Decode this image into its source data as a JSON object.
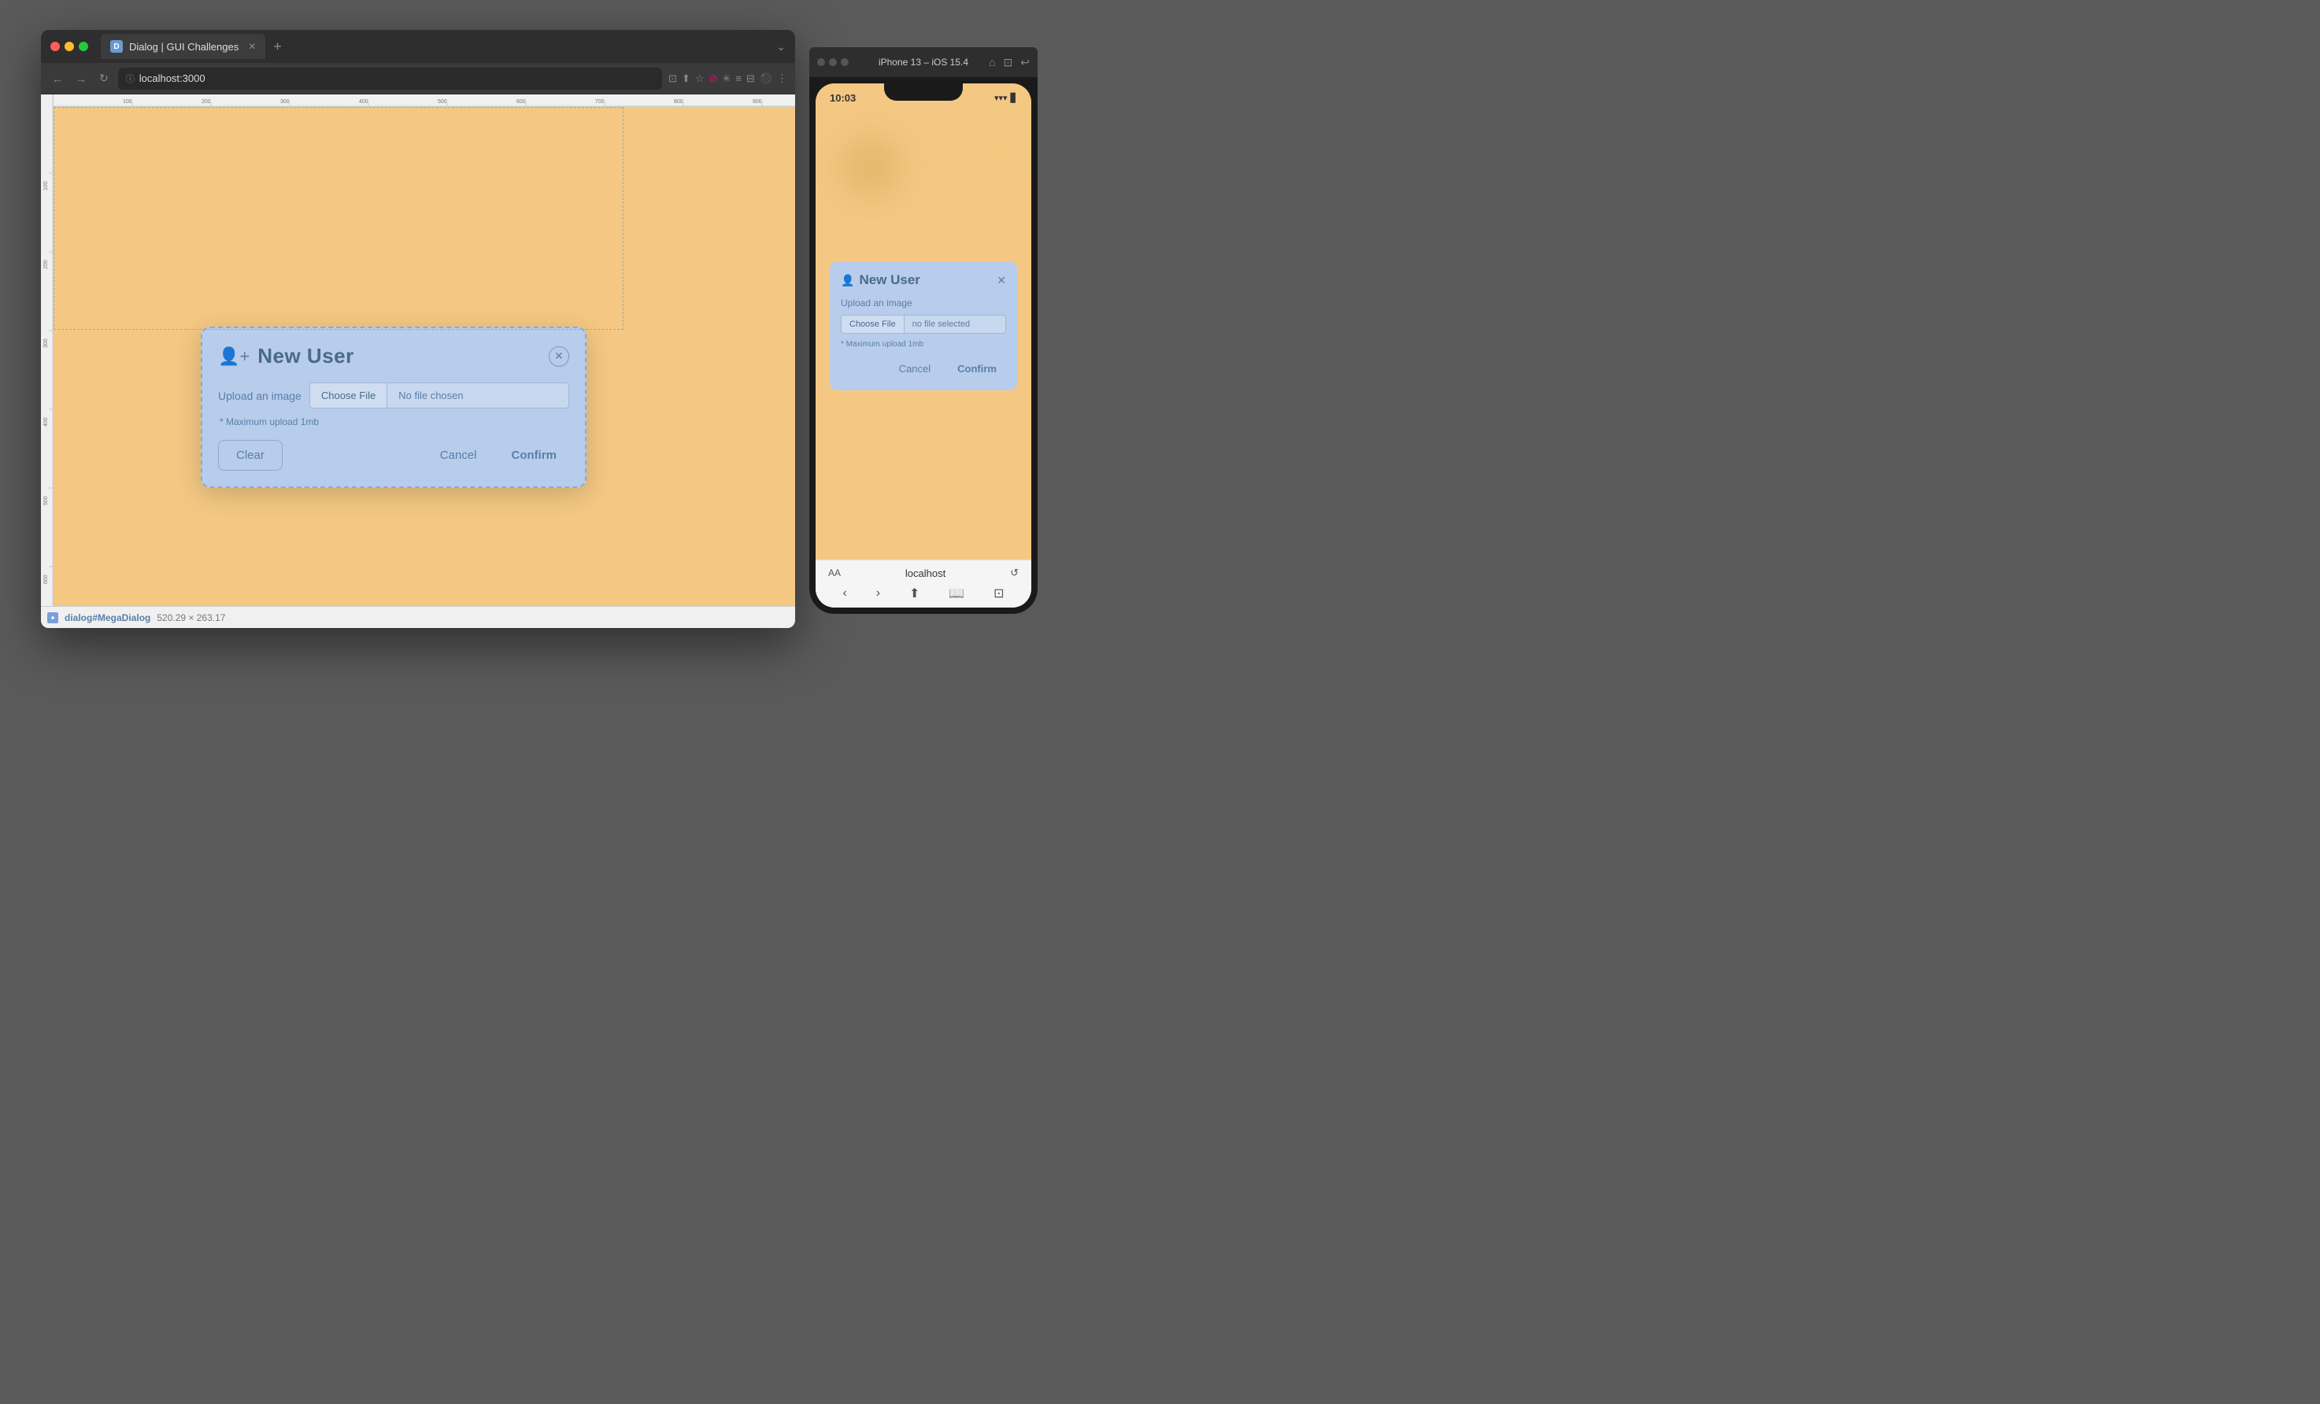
{
  "browser": {
    "tab_title": "Dialog | GUI Challenges",
    "address": "localhost:3000",
    "traffic_lights": [
      "red",
      "yellow",
      "green"
    ],
    "nav_buttons": [
      "←",
      "→",
      "↻"
    ],
    "toolbar_icons": [
      "⊡",
      "⬆",
      "★",
      "⊘",
      "✳",
      "≡",
      "⊟",
      "⚫",
      "⋮"
    ]
  },
  "dialog": {
    "title": "New User",
    "upload_label": "Upload an image",
    "choose_file_btn": "Choose File",
    "no_file_text": "No file chosen",
    "max_upload_note": "* Maximum upload 1mb",
    "clear_btn": "Clear",
    "cancel_btn": "Cancel",
    "confirm_btn": "Confirm"
  },
  "iphone": {
    "device_title": "iPhone 13 – iOS 15.4",
    "time": "10:03",
    "status_icons": "... ▼ ▊",
    "dialog": {
      "title": "New User",
      "upload_label": "Upload an image",
      "choose_file_btn": "Choose File",
      "no_file_text": "no file selected",
      "max_upload_note": "* Maximum upload 1mb",
      "cancel_btn": "Cancel",
      "confirm_btn": "Confirm"
    },
    "url_bar": {
      "aa": "AA",
      "url": "localhost",
      "refresh": "↺"
    }
  },
  "statusbar": {
    "selector_text": "dialog#MegaDialog",
    "dimensions": "520.29 × 263.17"
  },
  "ruler": {
    "top_labels": [
      "100",
      "200",
      "300",
      "400",
      "500",
      "600",
      "700",
      "800",
      "900"
    ],
    "left_labels": [
      "100",
      "200",
      "300",
      "400",
      "500",
      "600"
    ]
  }
}
